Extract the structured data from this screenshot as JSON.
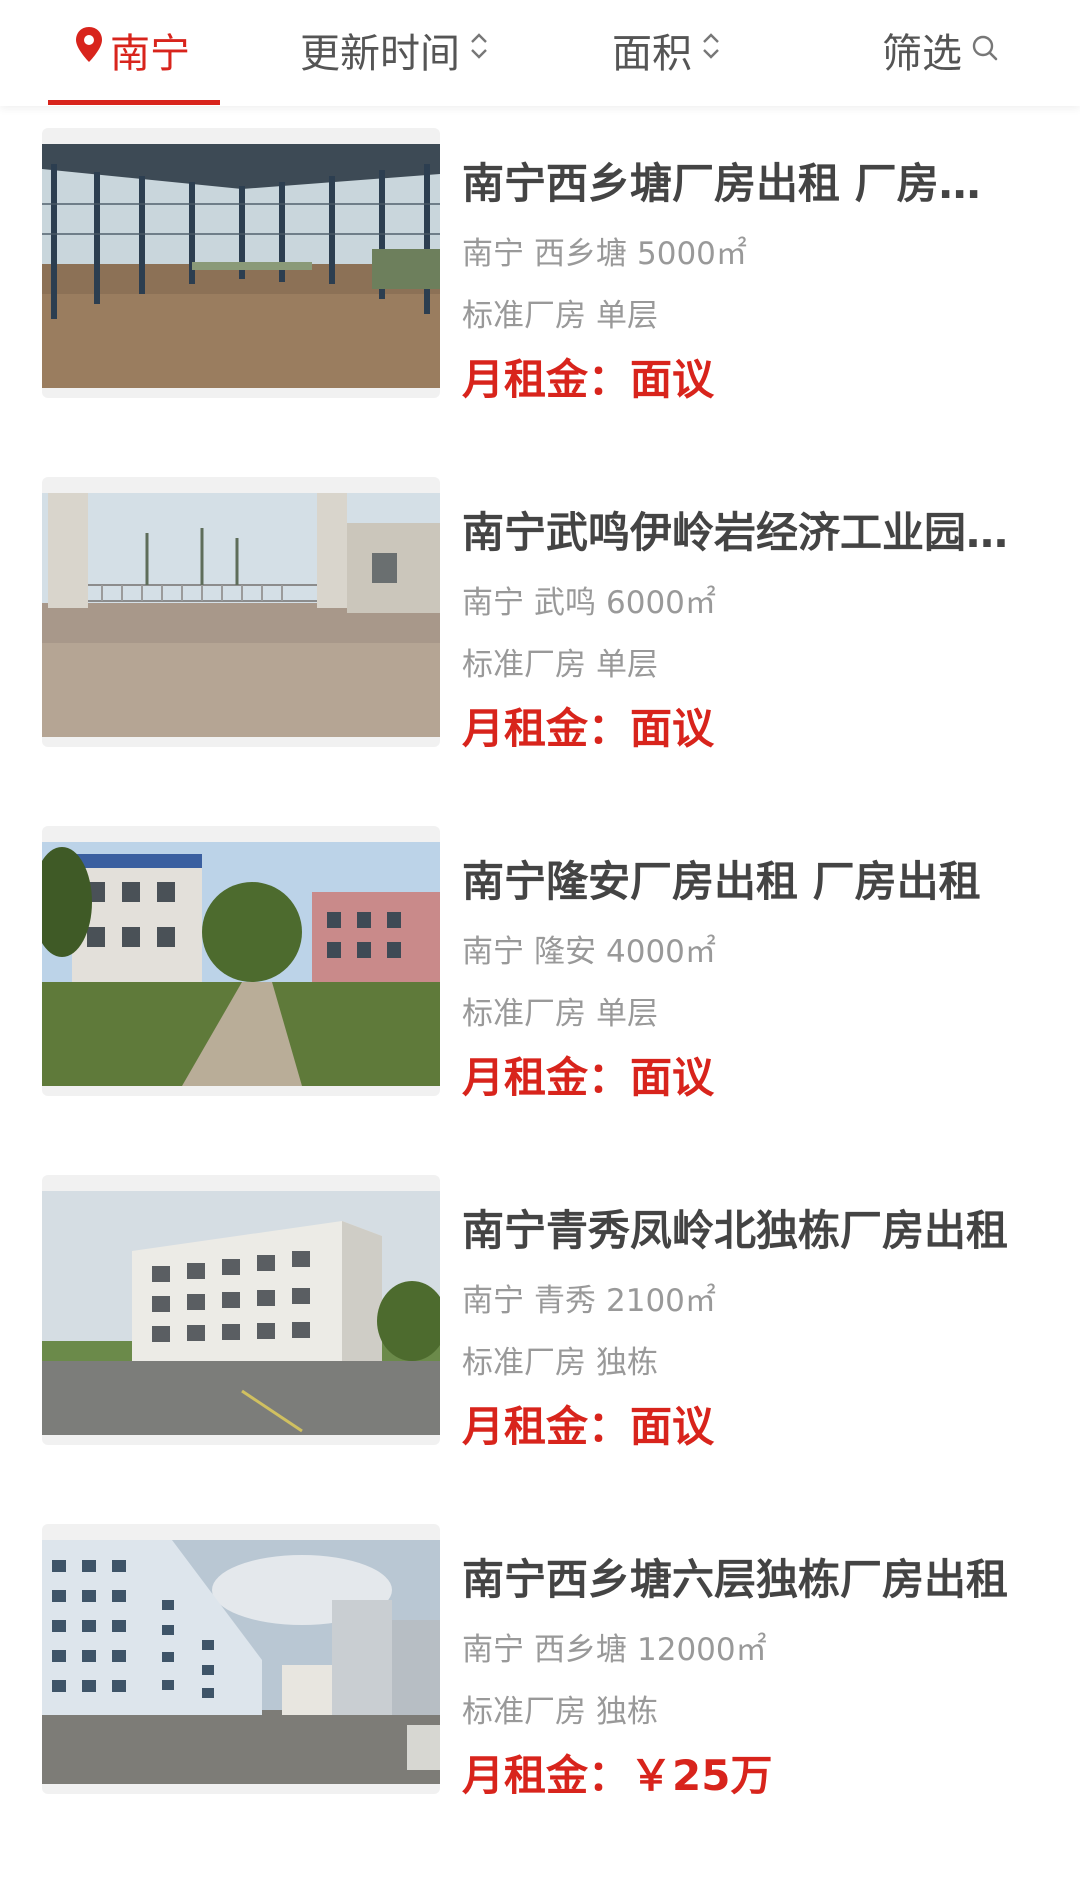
{
  "filter_bar": {
    "location": "南宁",
    "update_time": "更新时间",
    "area": "面积",
    "filter": "筛选"
  },
  "listings": [
    {
      "title": "南宁西乡塘厂房出租 厂房出租",
      "city": "南宁",
      "district": "西乡塘",
      "area": "5000㎡",
      "type": "标准厂房",
      "structure": "单层",
      "price_label": "月租金：",
      "price": "面议"
    },
    {
      "title": "南宁武鸣伊岭岩经济工业园厂房",
      "city": "南宁",
      "district": "武鸣",
      "area": "6000㎡",
      "type": "标准厂房",
      "structure": "单层",
      "price_label": "月租金：",
      "price": "面议"
    },
    {
      "title": "南宁隆安厂房出租 厂房出租",
      "city": "南宁",
      "district": "隆安",
      "area": "4000㎡",
      "type": "标准厂房",
      "structure": "单层",
      "price_label": "月租金：",
      "price": "面议"
    },
    {
      "title": "南宁青秀凤岭北独栋厂房出租",
      "city": "南宁",
      "district": "青秀",
      "area": "2100㎡",
      "type": "标准厂房",
      "structure": "独栋",
      "price_label": "月租金：",
      "price": "面议"
    },
    {
      "title": "南宁西乡塘六层独栋厂房出租",
      "city": "南宁",
      "district": "西乡塘",
      "area": "12000㎡",
      "type": "标准厂房",
      "structure": "独栋",
      "price_label": "月租金：",
      "price": "￥25万"
    }
  ],
  "colors": {
    "accent": "#d8241c",
    "title": "#444444",
    "meta": "#999999"
  }
}
